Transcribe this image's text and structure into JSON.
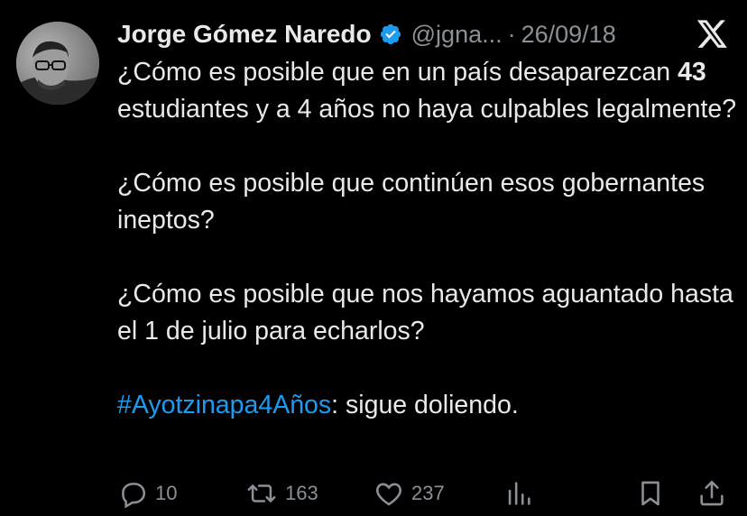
{
  "tweet": {
    "author_name": "Jorge Gómez Naredo",
    "handle": "@jgna...",
    "separator": "·",
    "date": "26/09/18",
    "paragraphs": [
      {
        "pre": "¿Cómo es posible que en un país desaparezcan ",
        "bold": "43",
        "post": " estudiantes y a 4 años no haya culpables legalmente?"
      },
      {
        "text": "¿Cómo es posible que continúen esos gobernantes ineptos?"
      },
      {
        "text": "¿Cómo es posible que nos hayamos aguantado hasta el 1 de julio para echarlos?"
      },
      {
        "hashtag": "#Ayotzinapa4Años",
        "post": ": sigue doliendo."
      }
    ]
  },
  "actions": {
    "replies": "10",
    "retweets": "163",
    "likes": "237"
  },
  "icons": [
    "verified-badge-icon",
    "x-logo-icon",
    "reply-icon",
    "retweet-icon",
    "like-icon",
    "views-icon",
    "bookmark-icon",
    "share-icon"
  ],
  "colors": {
    "background": "#000000",
    "text": "#e7e9ea",
    "secondary": "#8b9097",
    "accent": "#1d9bf0"
  }
}
